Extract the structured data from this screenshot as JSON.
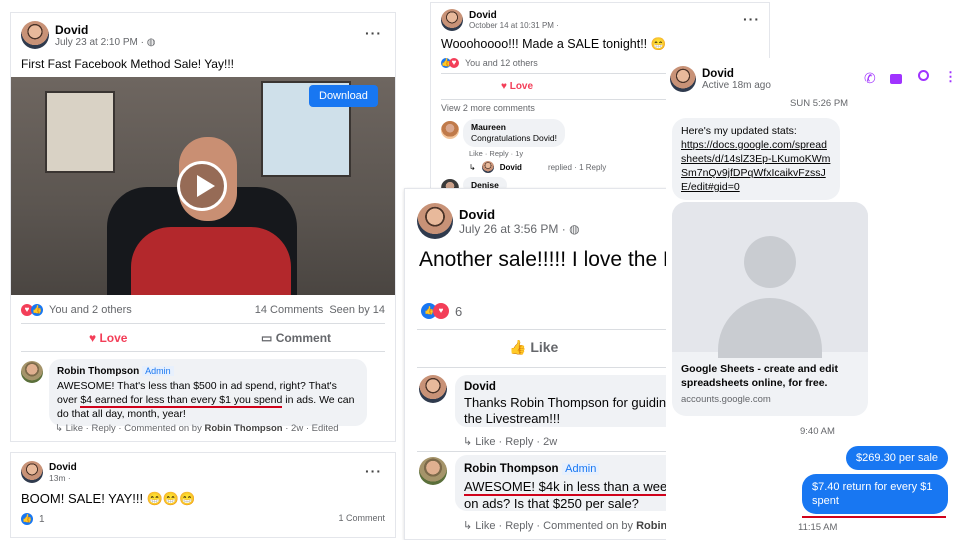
{
  "post1": {
    "author": "Dovid",
    "time": "July 23 at 2:10 PM ·",
    "text": "First Fast Facebook Method Sale! Yay!!!",
    "download": "Download",
    "reactions": "You and 2 others",
    "comments": "14 Comments",
    "seen": "Seen by 14",
    "love": "Love",
    "comment": "Comment",
    "reply": {
      "author": "Robin Thompson",
      "badge": "Admin",
      "text_pre": "AWESOME! That's less than $500 in ad spend, right? That's over ",
      "text_ul": "$4 earned for less than every $1 you spend",
      "text_post": " in ads. We can do that all day, month, year!",
      "actions": "Like · Reply · Commented on by",
      "commenter": "Robin Thompson",
      "age": "· 2w · Edited"
    }
  },
  "post2": {
    "author": "Dovid",
    "time": "13m ·",
    "text": "BOOM! SALE! YAY!!! 😁😁😁",
    "count": "1",
    "comments": "1 Comment"
  },
  "post3": {
    "author": "Dovid",
    "time": "October 14 at 10:31 PM ·",
    "text": "Wooohoooo!!! Made a SALE tonight!! 😁",
    "reactions": "You and 12 others",
    "love": "Love",
    "view_more": "View 2 more comments",
    "c1_author": "Maureen",
    "c1_text": "Congratulations Dovid!",
    "c1_actions": "Like · Reply · 1y",
    "reply_author": "Dovid",
    "reply_text": "replied · 1 Reply",
    "c2_author": "Denise"
  },
  "post4": {
    "author": "Dovid",
    "time": "July 26 at 3:56 PM ·",
    "text": "Another sale!!!!! I love the Fast Method!!!!",
    "count": "6",
    "like": "Like",
    "c1": {
      "author": "Dovid",
      "text": "Thanks Robin Thompson for guiding me through the Livestream!!!",
      "actions": "Like · Reply · 2w"
    },
    "c2": {
      "author": "Robin Thompson",
      "badge": "Admin",
      "text_ul": "AWESOME! $4k in less than a week",
      "text_post": " on ads? Is that $250 per sale?",
      "actions": "Like · Reply · Commented on by",
      "commenter": "Robin"
    }
  },
  "messenger": {
    "name": "Dovid",
    "status": "Active 18m ago",
    "time1": "SUN 5:26 PM",
    "msg_intro": "Here's my updated stats:",
    "msg_link": "https://docs.google.com/spreadsheets/d/14slZ3Ep-LKumoKWmSm7nQv9jfDPqWfxIcaikvFzssJE/edit#gid=0",
    "preview_title": "Google Sheets - create and edit spreadsheets online, for free.",
    "preview_domain": "accounts.google.com",
    "time2": "9:40 AM",
    "out1": "$269.30 per sale",
    "out2": "$7.40 return for every $1 spent",
    "time3": "11:15 AM"
  },
  "colors": {
    "fb_blue": "#1877f2",
    "messenger_purple": "#a033ff",
    "underline_red": "#d0021b"
  }
}
